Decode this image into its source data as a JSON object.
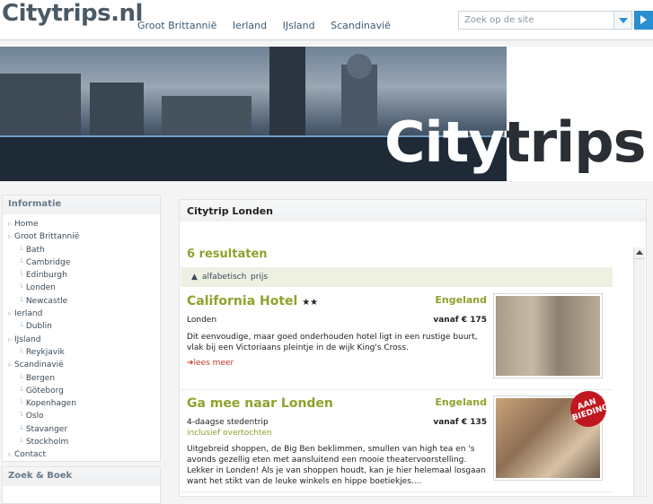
{
  "header": {
    "logo": "Citytrips.nl",
    "nav": [
      "Groot Brittannië",
      "Ierland",
      "IJsland",
      "Scandinavië"
    ],
    "search_placeholder": "Zoek op de site"
  },
  "banner": {
    "text": "Citytrips"
  },
  "sidebar": {
    "title": "Informatie",
    "items": [
      {
        "label": "Home",
        "level": 1
      },
      {
        "label": "Groot Brittannië",
        "level": 1
      },
      {
        "label": "Bath",
        "level": 2
      },
      {
        "label": "Cambridge",
        "level": 2
      },
      {
        "label": "Edinburgh",
        "level": 2
      },
      {
        "label": "Londen",
        "level": 2
      },
      {
        "label": "Newcastle",
        "level": 2
      },
      {
        "label": "Ierland",
        "level": 1
      },
      {
        "label": "Dublin",
        "level": 2
      },
      {
        "label": "IJsland",
        "level": 1
      },
      {
        "label": "Reykjavik",
        "level": 2
      },
      {
        "label": "Scandinavië",
        "level": 1
      },
      {
        "label": "Bergen",
        "level": 2
      },
      {
        "label": "Göteborg",
        "level": 2
      },
      {
        "label": "Kopenhagen",
        "level": 2
      },
      {
        "label": "Oslo",
        "level": 2
      },
      {
        "label": "Stavanger",
        "level": 2
      },
      {
        "label": "Stockholm",
        "level": 2
      },
      {
        "label": "Contact",
        "level": 1
      }
    ],
    "title2": "Zoek & Boek"
  },
  "main": {
    "title": "Citytrip Londen",
    "results": "6 resultaten",
    "sort": {
      "alpha": "alfabetisch",
      "price": "prijs"
    },
    "cards": [
      {
        "title": "California Hotel",
        "stars": "★★",
        "country": "Engeland",
        "city": "Londen",
        "price": "vanaf € 175",
        "sub": "",
        "desc": "Dit eenvoudige, maar goed onderhouden hotel ligt in een rustige buurt, vlak bij een Victoriaans pleintje in de wijk King's Cross.",
        "more": "lees meer"
      },
      {
        "title": "Ga mee naar Londen",
        "stars": "",
        "country": "Engeland",
        "city": "4-daagse stedentrip",
        "price": "vanaf € 135",
        "sub": "inclusief overtochten",
        "desc": "Uitgebreid shoppen, de Big Ben beklimmen, smullen van high tea en 's avonds gezellig eten met aansluitend een mooie theatervoorstelling. Lekker in Londen! Als je van shoppen houdt, kan je hier helemaal losgaan want het stikt van de leuke winkels en hippe boetiekjes....",
        "badge": "AAN BIEDING"
      }
    ]
  }
}
